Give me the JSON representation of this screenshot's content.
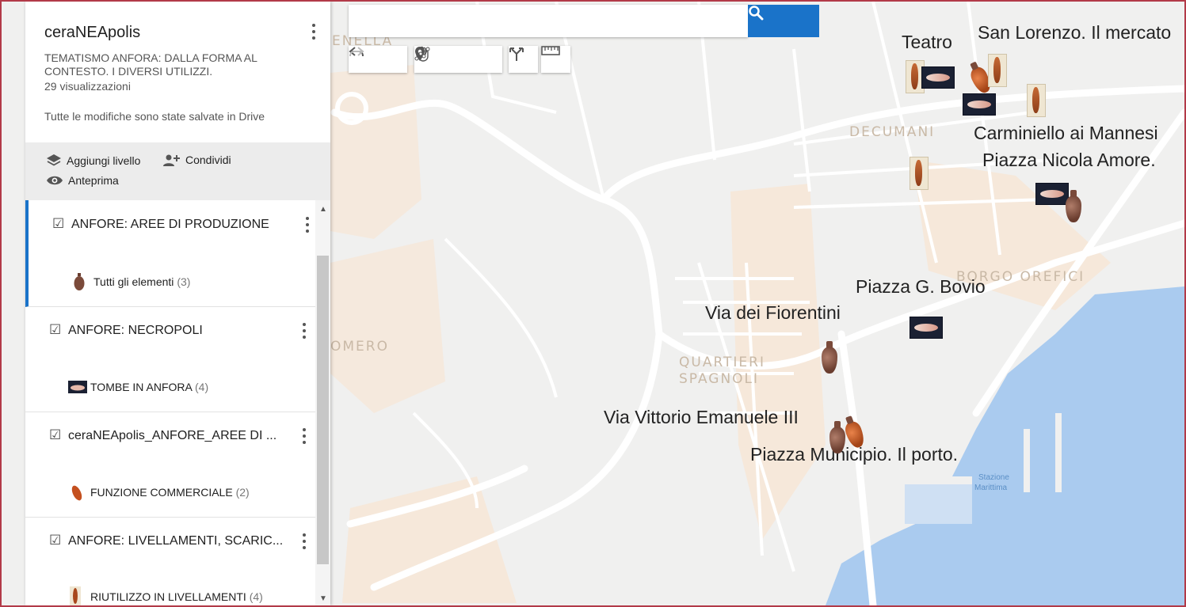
{
  "sidebar": {
    "title": "ceraNEApolis",
    "description": "TEMATISMO ANFORA: DALLA FORMA AL CONTESTO. I  DIVERSI  UTILIZZI.",
    "views": "29 visualizzazioni",
    "saved_status": "Tutte le modifiche sono state salvate in Drive",
    "actions": {
      "add_layer": "Aggiungi livello",
      "share": "Condividi",
      "preview": "Anteprima"
    },
    "layers": [
      {
        "name": "ANFORE: AREE DI PRODUZIONE",
        "item_label": "Tutti gli elementi",
        "item_count": "(3)",
        "checked": true,
        "active": true
      },
      {
        "name": "ANFORE: NECROPOLI",
        "item_label": "TOMBE IN ANFORA",
        "item_count": "(4)",
        "checked": true,
        "active": false
      },
      {
        "name": "ceraNEApolis_ANFORE_AREE DI ...",
        "item_label": "FUNZIONE COMMERCIALE",
        "item_count": "(2)",
        "checked": true,
        "active": false
      },
      {
        "name": "ANFORE: LIVELLAMENTI, SCARIC...",
        "item_label": "RIUTILIZZO IN LIVELLAMENTI",
        "item_count": "(4)",
        "checked": true,
        "active": false
      }
    ]
  },
  "search": {
    "placeholder": ""
  },
  "toolbar": {
    "tools": [
      "undo-icon",
      "redo-icon",
      "hand-icon",
      "marker-icon",
      "draw-line-icon",
      "directions-icon",
      "ruler-icon"
    ]
  },
  "map": {
    "districts": {
      "decumani": "DECUMANI",
      "borgo_orefici": "BORGO OREFICI",
      "vomero": "OMERO",
      "quartieri_1": "QUARTIERI",
      "quartieri_2": "SPAGNOLI",
      "nella": "ENELLA"
    },
    "station_1": "Stazione",
    "station_2": "Marittima",
    "labels": {
      "teatro": "Teatro",
      "san_lorenzo": "San Lorenzo. Il mercato",
      "carminiello": "Carminiello ai Mannesi",
      "nicola_amore": "Piazza Nicola Amore.",
      "bovio": "Piazza G. Bovio",
      "fiorentini": "Via dei Fiorentini",
      "vittorio_emanuele": "Via Vittorio Emanuele  III",
      "municipio": "Piazza Municipio. Il porto."
    }
  },
  "colors": {
    "accent": "#1a73c9",
    "frame": "#b23a48",
    "water": "#aacbef",
    "land": "#f0f0ef"
  }
}
